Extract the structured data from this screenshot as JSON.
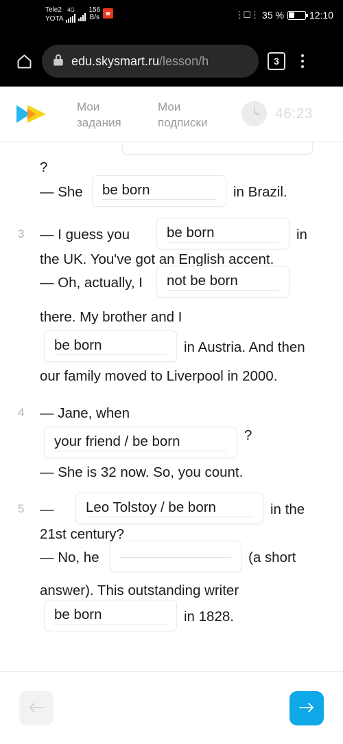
{
  "status_bar": {
    "carrier_1": "Tele2",
    "carrier_2": "YOTA",
    "network_type": "4G",
    "data_speed_value": "156",
    "data_speed_unit": "B/s",
    "battery_percent": "35 %",
    "clock": "12:10",
    "vibrate_icon": "vibrate-icon"
  },
  "browser": {
    "home_icon": "home-icon",
    "lock_icon": "lock-icon",
    "url_visible": "edu.skysmart.ru",
    "url_path": "/lesson/h",
    "tab_count": "3",
    "menu_icon": "kebab-menu-icon"
  },
  "app_header": {
    "logo": "skysmart-logo",
    "nav": [
      {
        "line1": "Мои",
        "line2": "задания"
      },
      {
        "line1": "Мои",
        "line2": "подписки"
      }
    ],
    "timer_icon": "clock-icon",
    "timer": "46:23"
  },
  "exercise": {
    "item_2_tail": {
      "question_mark": "?",
      "dash_she": "— She",
      "blank": "be born",
      "tail": "in Brazil."
    },
    "items": [
      {
        "number": "3",
        "parts": [
          {
            "type": "text",
            "value": "— I guess you"
          },
          {
            "type": "blank",
            "value": "be born"
          },
          {
            "type": "text",
            "value": "in"
          },
          {
            "type": "text",
            "value": "the UK. You've got an English accent."
          },
          {
            "type": "text",
            "value": "— Oh, actually, I"
          },
          {
            "type": "blank",
            "value": "not be born"
          },
          {
            "type": "text",
            "value": "there. My brother and I"
          },
          {
            "type": "blank",
            "value": "be born"
          },
          {
            "type": "text",
            "value": "in Austria. And then"
          },
          {
            "type": "text",
            "value": "our family moved to Liverpool in 2000."
          }
        ]
      },
      {
        "number": "4",
        "parts": [
          {
            "type": "text",
            "value": "— Jane, when"
          },
          {
            "type": "blank",
            "value": "your friend / be born"
          },
          {
            "type": "text",
            "value": "?"
          },
          {
            "type": "text",
            "value": "— She is 32 now. So, you count."
          }
        ]
      },
      {
        "number": "5",
        "parts": [
          {
            "type": "text",
            "value": "—"
          },
          {
            "type": "blank",
            "value": "Leo Tolstoy / be born"
          },
          {
            "type": "text",
            "value": "in the"
          },
          {
            "type": "text",
            "value": "21st century?"
          },
          {
            "type": "text",
            "value": "— No, he"
          },
          {
            "type": "blank",
            "value": ""
          },
          {
            "type": "text",
            "value": "(a short"
          },
          {
            "type": "text",
            "value": "answer). This outstanding writer"
          },
          {
            "type": "blank",
            "value": "be born"
          },
          {
            "type": "text",
            "value": "in 1828."
          }
        ]
      }
    ]
  },
  "footer": {
    "prev_icon": "arrow-left-icon",
    "next_icon": "arrow-right-icon",
    "next_color": "#0fa8e8"
  }
}
